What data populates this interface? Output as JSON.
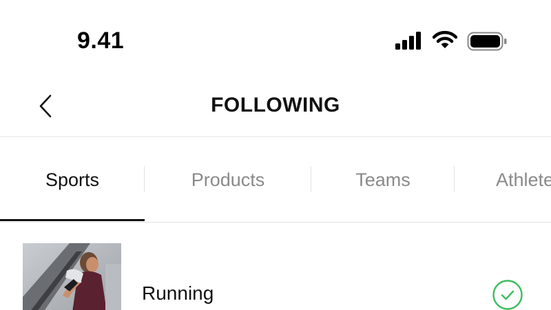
{
  "status_bar": {
    "time": "9.41",
    "icons": [
      "signal-icon",
      "wifi-icon",
      "battery-icon"
    ]
  },
  "header": {
    "title": "FOLLOWING",
    "back_icon": "chevron-left-icon"
  },
  "tabs": [
    {
      "label": "Sports",
      "active": true
    },
    {
      "label": "Products",
      "active": false
    },
    {
      "label": "Teams",
      "active": false
    },
    {
      "label": "Athletes",
      "active": false
    }
  ],
  "list": [
    {
      "label": "Running",
      "image": "runner-photo",
      "followed": true,
      "status_icon": "check-circle-icon"
    }
  ],
  "colors": {
    "accent_green": "#3dbd5d",
    "active_text": "#111111",
    "inactive_text": "#8a8a8a"
  }
}
